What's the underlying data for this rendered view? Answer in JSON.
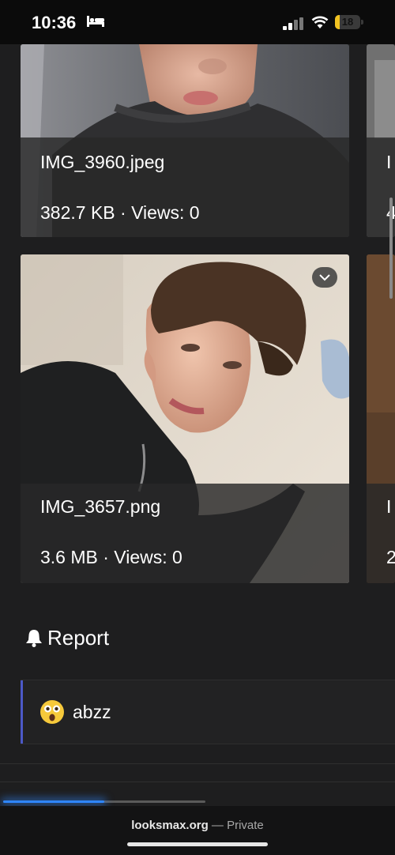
{
  "status_bar": {
    "time": "10:36",
    "battery_level": "18",
    "battery_fraction": 0.18
  },
  "gallery": {
    "cards": [
      {
        "filename": "IMG_3960.jpeg",
        "meta": "382.7 KB · Views: 0"
      },
      {
        "filename": "IMG_3657.png",
        "meta": "3.6 MB · Views: 0"
      }
    ],
    "partial_cards": [
      {
        "filename_start": "I",
        "meta_start": "4"
      },
      {
        "filename_start": "I",
        "meta_start": "2"
      }
    ]
  },
  "report": {
    "label": "Report",
    "icon": "bell-icon"
  },
  "reaction": {
    "emoji": "astonished-face-icon",
    "user": "abzz"
  },
  "browser": {
    "domain": "looksmax.org",
    "separator": " — ",
    "mode": "Private",
    "load_progress": 0.5
  },
  "colors": {
    "accent_bar": "#4c59c7",
    "progress": "#2f86ff",
    "battery": "#f2c321"
  }
}
